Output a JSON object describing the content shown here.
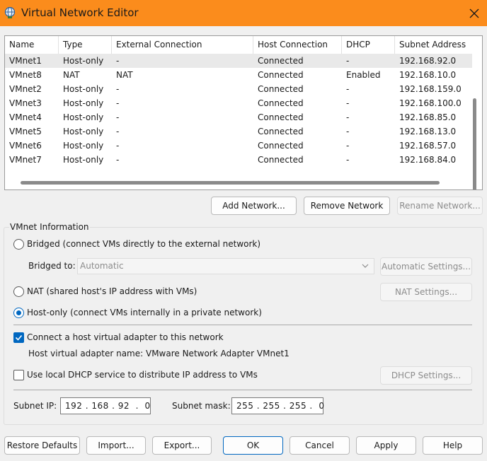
{
  "window": {
    "title": "Virtual Network Editor"
  },
  "list": {
    "columns": [
      "Name",
      "Type",
      "External Connection",
      "Host Connection",
      "DHCP",
      "Subnet Address"
    ],
    "rows": [
      [
        "VMnet1",
        "Host-only",
        "-",
        "Connected",
        "-",
        "192.168.92.0"
      ],
      [
        "VMnet8",
        "NAT",
        "NAT",
        "Connected",
        "Enabled",
        "192.168.10.0"
      ],
      [
        "VMnet2",
        "Host-only",
        "-",
        "Connected",
        "-",
        "192.168.159.0"
      ],
      [
        "VMnet3",
        "Host-only",
        "-",
        "Connected",
        "-",
        "192.168.100.0"
      ],
      [
        "VMnet4",
        "Host-only",
        "-",
        "Connected",
        "-",
        "192.168.85.0"
      ],
      [
        "VMnet5",
        "Host-only",
        "-",
        "Connected",
        "-",
        "192.168.13.0"
      ],
      [
        "VMnet6",
        "Host-only",
        "-",
        "Connected",
        "-",
        "192.168.57.0"
      ],
      [
        "VMnet7",
        "Host-only",
        "-",
        "Connected",
        "-",
        "192.168.84.0"
      ]
    ],
    "selected_row": 0
  },
  "network_buttons": {
    "add": "Add Network...",
    "remove": "Remove Network",
    "rename": "Rename Network..."
  },
  "vmnet_info": {
    "group_label": "VMnet Information",
    "bridged_label": "Bridged (connect VMs directly to the external network)",
    "bridged_to_label": "Bridged to:",
    "bridged_to_value": "Automatic",
    "automatic_settings": "Automatic Settings...",
    "nat_label": "NAT (shared host's IP address with VMs)",
    "nat_settings": "NAT Settings...",
    "hostonly_label": "Host-only (connect VMs internally in a private network)",
    "selected_mode": "host-only",
    "connect_adapter_label": "Connect a host virtual adapter to this network",
    "connect_adapter_checked": true,
    "adapter_name_text": "Host virtual adapter name: VMware Network Adapter VMnet1",
    "dhcp_label": "Use local DHCP service to distribute IP address to VMs",
    "dhcp_checked": false,
    "dhcp_settings": "DHCP Settings...",
    "subnet_ip_label": "Subnet IP:",
    "subnet_ip_value": "192 . 168 . 92  .  0",
    "subnet_mask_label": "Subnet mask:",
    "subnet_mask_value": "255 . 255 . 255 .  0"
  },
  "bottom_buttons": {
    "restore": "Restore Defaults",
    "import": "Import...",
    "export": "Export...",
    "ok": "OK",
    "cancel": "Cancel",
    "apply": "Apply",
    "help": "Help"
  },
  "colors": {
    "titlebar": "#fb8c1c",
    "accent": "#0067c0",
    "selected_row": "#e9e9e9"
  }
}
